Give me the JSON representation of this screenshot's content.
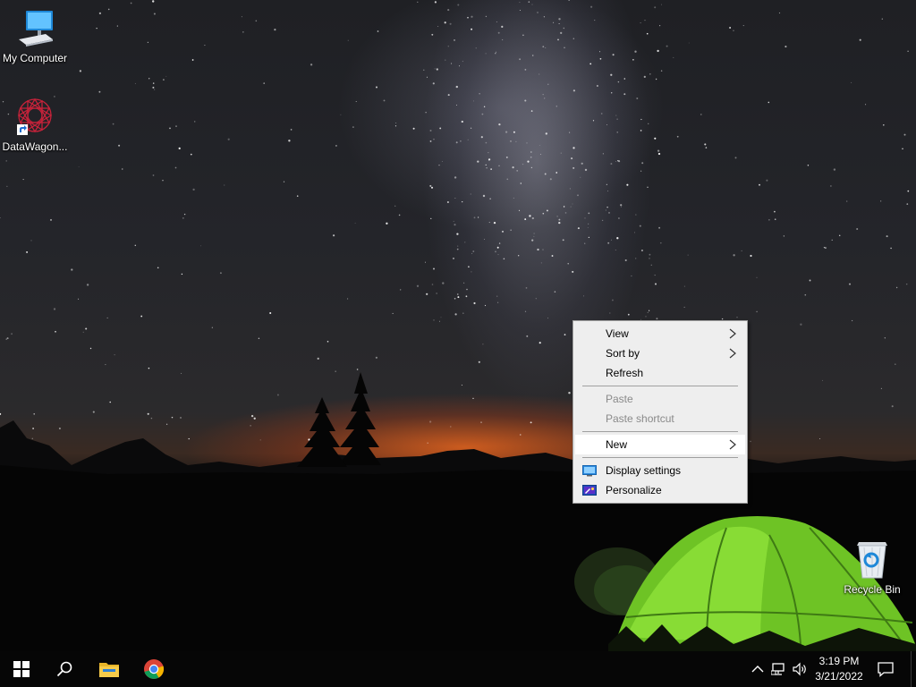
{
  "desktop": {
    "icons": [
      {
        "label": "My Computer",
        "icon": "computer-monitor-icon"
      },
      {
        "label": "DataWagon...",
        "icon": "datawagon-shortcut-icon"
      },
      {
        "label": "Recycle Bin",
        "icon": "recycle-bin-icon"
      }
    ]
  },
  "context_menu": {
    "items": {
      "view": {
        "label": "View",
        "has_submenu": true,
        "enabled": true
      },
      "sort_by": {
        "label": "Sort by",
        "has_submenu": true,
        "enabled": true
      },
      "refresh": {
        "label": "Refresh",
        "enabled": true
      },
      "paste": {
        "label": "Paste",
        "enabled": false
      },
      "paste_shortcut": {
        "label": "Paste shortcut",
        "enabled": false
      },
      "new": {
        "label": "New",
        "has_submenu": true,
        "enabled": true,
        "highlighted": true
      },
      "display_settings": {
        "label": "Display settings",
        "icon": "display-settings-icon",
        "enabled": true
      },
      "personalize": {
        "label": "Personalize",
        "icon": "personalize-icon",
        "enabled": true
      }
    }
  },
  "taskbar": {
    "buttons": [
      "windows-start-icon",
      "search-icon",
      "file-explorer-icon",
      "chrome-icon"
    ],
    "tray": [
      "chevron-up-icon",
      "network-icon",
      "volume-icon"
    ],
    "clock": {
      "time": "3:19 PM",
      "date": "3/21/2022"
    },
    "notification_icon": "action-center-icon"
  },
  "colors": {
    "taskbar_bg": "#060606",
    "menu_bg": "#eeeeee",
    "menu_highlight": "#ffffff",
    "tent_green": "#7bd32a"
  }
}
